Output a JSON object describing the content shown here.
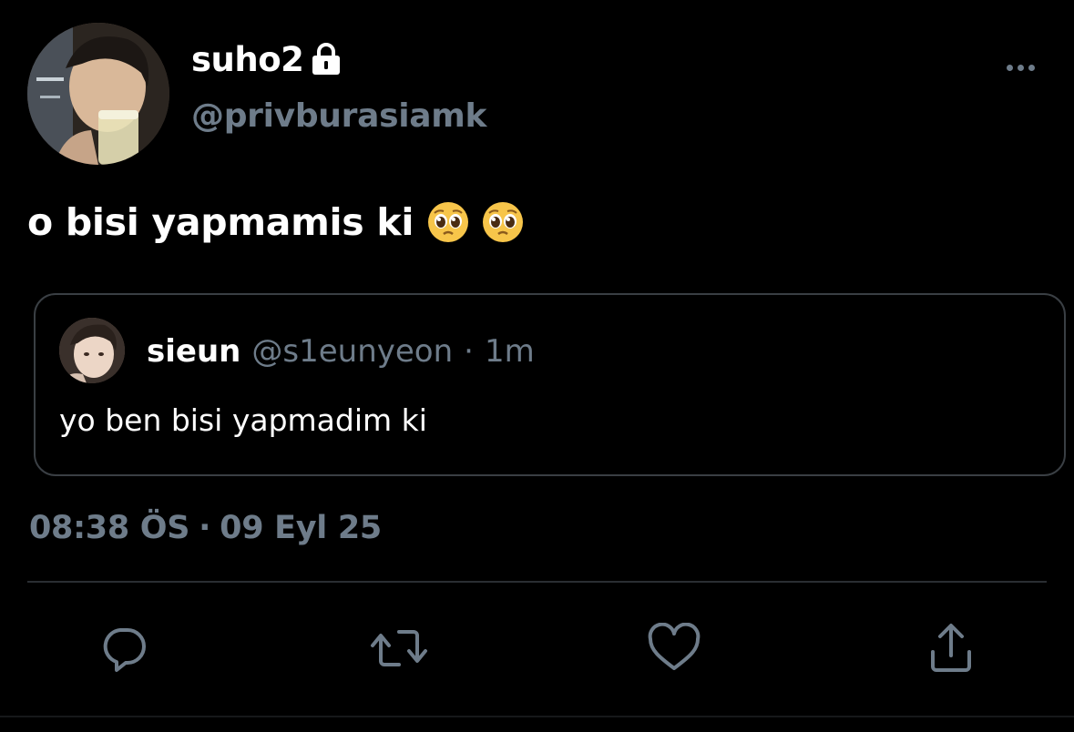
{
  "author": {
    "display_name": "suho2",
    "handle": "@privburasiamk",
    "protected": true
  },
  "tweet": {
    "text": "o bisi yapmamis ki",
    "emojis": [
      "pleading-face",
      "pleading-face"
    ]
  },
  "quoted_tweet": {
    "display_name": "sieun",
    "handle": "@s1eunyeon",
    "separator": "·",
    "time": "1m",
    "text": "yo ben bisi yapmadim ki"
  },
  "meta": {
    "time": "08:38 ÖS",
    "separator": "·",
    "date": "09 Eyl 25"
  },
  "actions": [
    {
      "name": "reply",
      "icon": "reply-icon"
    },
    {
      "name": "retweet",
      "icon": "retweet-icon"
    },
    {
      "name": "like",
      "icon": "heart-icon"
    },
    {
      "name": "share",
      "icon": "share-icon"
    }
  ],
  "colors": {
    "background": "#000000",
    "primary_text": "#ffffff",
    "secondary_text": "#6e7c8a",
    "border": "#3a3f44"
  }
}
